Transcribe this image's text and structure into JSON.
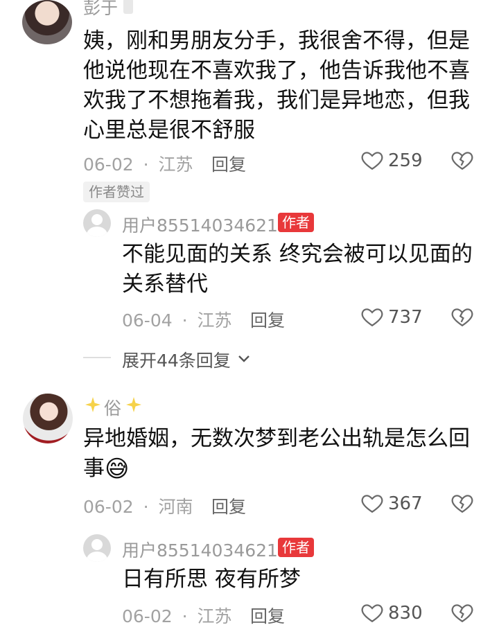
{
  "comments": [
    {
      "username": "彭于",
      "text_lines": [
        "姨，刚和男朋友分手，我很舍不得，但是",
        "他说他现在不喜欢我了，他告诉我他不喜",
        "欢我了不想拖着我，我们是异地恋，但我",
        "心里总是很不舒服"
      ],
      "date": "06-02",
      "location": "江苏",
      "reply_label": "回复",
      "likes": "259",
      "tag": "作者赞过",
      "sub_reply": {
        "username": "用户85514034621",
        "badge": "作者",
        "text_lines": [
          "不能见面的关系 终究会被可以见面的",
          "关系替代"
        ],
        "date": "06-04",
        "location": "江苏",
        "reply_label": "回复",
        "likes": "737"
      },
      "expand_label": "展开44条回复"
    },
    {
      "username": "俗",
      "text_lines": [
        "异地婚姻，无数次梦到老公出轨是怎么回",
        "事"
      ],
      "emoji": "😅",
      "date": "06-02",
      "location": "河南",
      "reply_label": "回复",
      "likes": "367",
      "sub_reply": {
        "username": "用户85514034621",
        "badge": "作者",
        "text_lines": [
          "日有所思 夜有所梦"
        ],
        "date": "06-02",
        "location": "江苏",
        "reply_label": "回复",
        "likes": "830"
      }
    }
  ],
  "meta_separator": "·",
  "icons": {
    "like": "heart-outline-icon",
    "dislike": "broken-heart-icon",
    "expand": "chevron-down-icon",
    "sparkle": "sparkle-icon"
  }
}
